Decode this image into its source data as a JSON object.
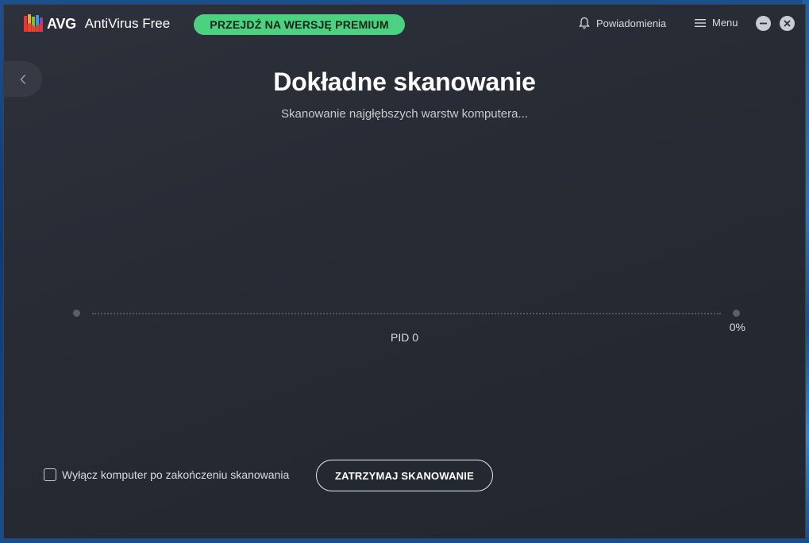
{
  "app": {
    "brand": "AVG",
    "product": "AntiVirus Free",
    "premium_button": "PRZEJDŹ NA WERSJĘ PREMIUM",
    "notifications_label": "Powiadomienia",
    "menu_label": "Menu"
  },
  "scan": {
    "title": "Dokładne skanowanie",
    "subtitle": "Skanowanie najgłębszych warstw komputera...",
    "progress_percent": 0,
    "progress_label": "0%",
    "current_item": "PID 0",
    "shutdown_checkbox_label": "Wyłącz komputer po zakończeniu skanowania",
    "shutdown_checked": false,
    "stop_button": "ZATRZYMAJ SKANOWANIE"
  },
  "icons": {
    "back": "chevron-left-icon",
    "notifications": "bell-icon",
    "menu": "hamburger-icon",
    "minimize": "minimize-icon",
    "close": "close-icon"
  },
  "colors": {
    "accent": "#4bd17f",
    "window_bg": "#272b34",
    "text_primary": "#ffffff"
  }
}
